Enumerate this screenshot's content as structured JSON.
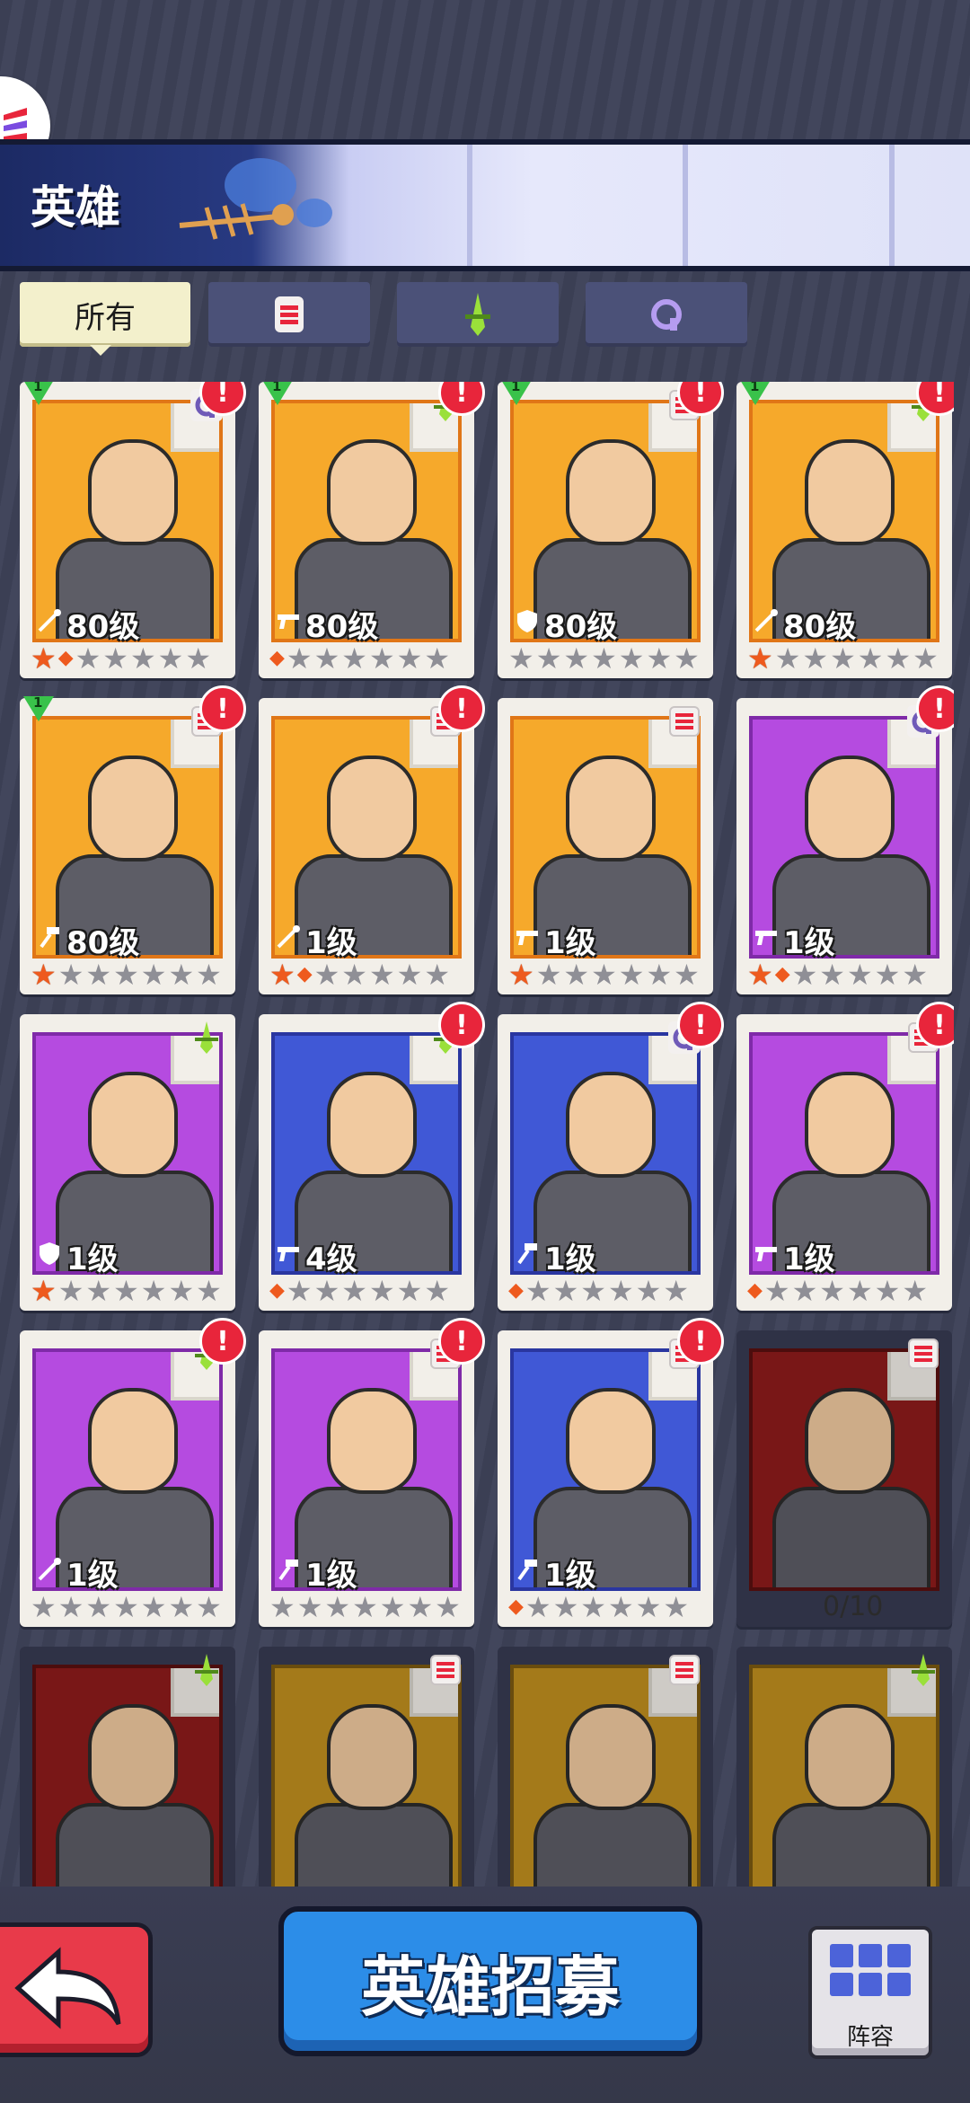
{
  "header": {
    "title": "英雄"
  },
  "filters": [
    {
      "label": "所有",
      "icon": "all",
      "active": true
    },
    {
      "label": "",
      "icon": "red-class-icon",
      "active": false
    },
    {
      "label": "",
      "icon": "green-dagger-icon",
      "active": false
    },
    {
      "label": "",
      "icon": "purple-q-icon",
      "active": false
    }
  ],
  "heroes": [
    {
      "level": "80级",
      "badge": "1",
      "class": "q",
      "frame": "gold",
      "weapon": "staff",
      "stars": 1,
      "half": true,
      "alert": true
    },
    {
      "level": "80级",
      "badge": "1",
      "class": "dagger",
      "frame": "gold",
      "weapon": "gun",
      "stars": 0,
      "half": true,
      "alert": true
    },
    {
      "level": "80级",
      "badge": "1",
      "class": "e",
      "frame": "gold",
      "weapon": "shield",
      "stars": 0,
      "half": false,
      "alert": true
    },
    {
      "level": "80级",
      "badge": "1",
      "class": "dagger",
      "frame": "gold",
      "weapon": "staff",
      "stars": 1,
      "half": false,
      "alert": true
    },
    {
      "level": "80级",
      "badge": "1",
      "class": "e",
      "frame": "gold",
      "weapon": "hammer",
      "stars": 1,
      "half": false,
      "alert": true
    },
    {
      "level": "1级",
      "badge": "",
      "class": "e",
      "frame": "gold",
      "weapon": "staff",
      "stars": 1,
      "half": true,
      "alert": true
    },
    {
      "level": "1级",
      "badge": "",
      "class": "e",
      "frame": "gold",
      "weapon": "gun",
      "stars": 1,
      "half": false,
      "alert": false
    },
    {
      "level": "1级",
      "badge": "",
      "class": "q",
      "frame": "purple",
      "weapon": "gun",
      "stars": 1,
      "half": true,
      "alert": true
    },
    {
      "level": "1级",
      "badge": "",
      "class": "dagger",
      "frame": "purple",
      "weapon": "shield",
      "stars": 1,
      "half": false,
      "alert": false
    },
    {
      "level": "4级",
      "badge": "",
      "class": "dagger",
      "frame": "blue",
      "weapon": "gun",
      "stars": 0,
      "half": true,
      "alert": true
    },
    {
      "level": "1级",
      "badge": "",
      "class": "q",
      "frame": "blue",
      "weapon": "hammer",
      "stars": 0,
      "half": true,
      "alert": true
    },
    {
      "level": "1级",
      "badge": "",
      "class": "e",
      "frame": "purple",
      "weapon": "gun",
      "stars": 0,
      "half": true,
      "alert": true
    },
    {
      "level": "1级",
      "badge": "",
      "class": "dagger",
      "frame": "purple",
      "weapon": "staff",
      "stars": 0,
      "half": false,
      "alert": true
    },
    {
      "level": "1级",
      "badge": "",
      "class": "e",
      "frame": "purple",
      "weapon": "hammer",
      "stars": 0,
      "half": false,
      "alert": true
    },
    {
      "level": "1级",
      "badge": "",
      "class": "e",
      "frame": "blue",
      "weapon": "hammer",
      "stars": 0,
      "half": true,
      "alert": true
    },
    {
      "level": "",
      "badge": "",
      "class": "e",
      "frame": "locked-red",
      "weapon": "",
      "stars": 0,
      "half": false,
      "alert": false,
      "fragments": "0/10"
    },
    {
      "level": "",
      "badge": "",
      "class": "dagger",
      "frame": "locked-red",
      "weapon": "",
      "stars": 0,
      "half": false,
      "alert": false
    },
    {
      "level": "",
      "badge": "",
      "class": "e",
      "frame": "locked-gold",
      "weapon": "",
      "stars": 0,
      "half": false,
      "alert": false
    },
    {
      "level": "",
      "badge": "",
      "class": "e",
      "frame": "locked-gold",
      "weapon": "",
      "stars": 0,
      "half": false,
      "alert": false
    },
    {
      "level": "",
      "badge": "",
      "class": "dagger",
      "frame": "locked-gold",
      "weapon": "",
      "stars": 0,
      "half": false,
      "alert": false
    }
  ],
  "bottom": {
    "recruit_label": "英雄招募",
    "lineup_label": "阵容"
  },
  "colors": {
    "alert": "#e8253b",
    "star_on": "#ee5a1e",
    "recruit": "#2c8de8",
    "back": "#e83a4a"
  }
}
